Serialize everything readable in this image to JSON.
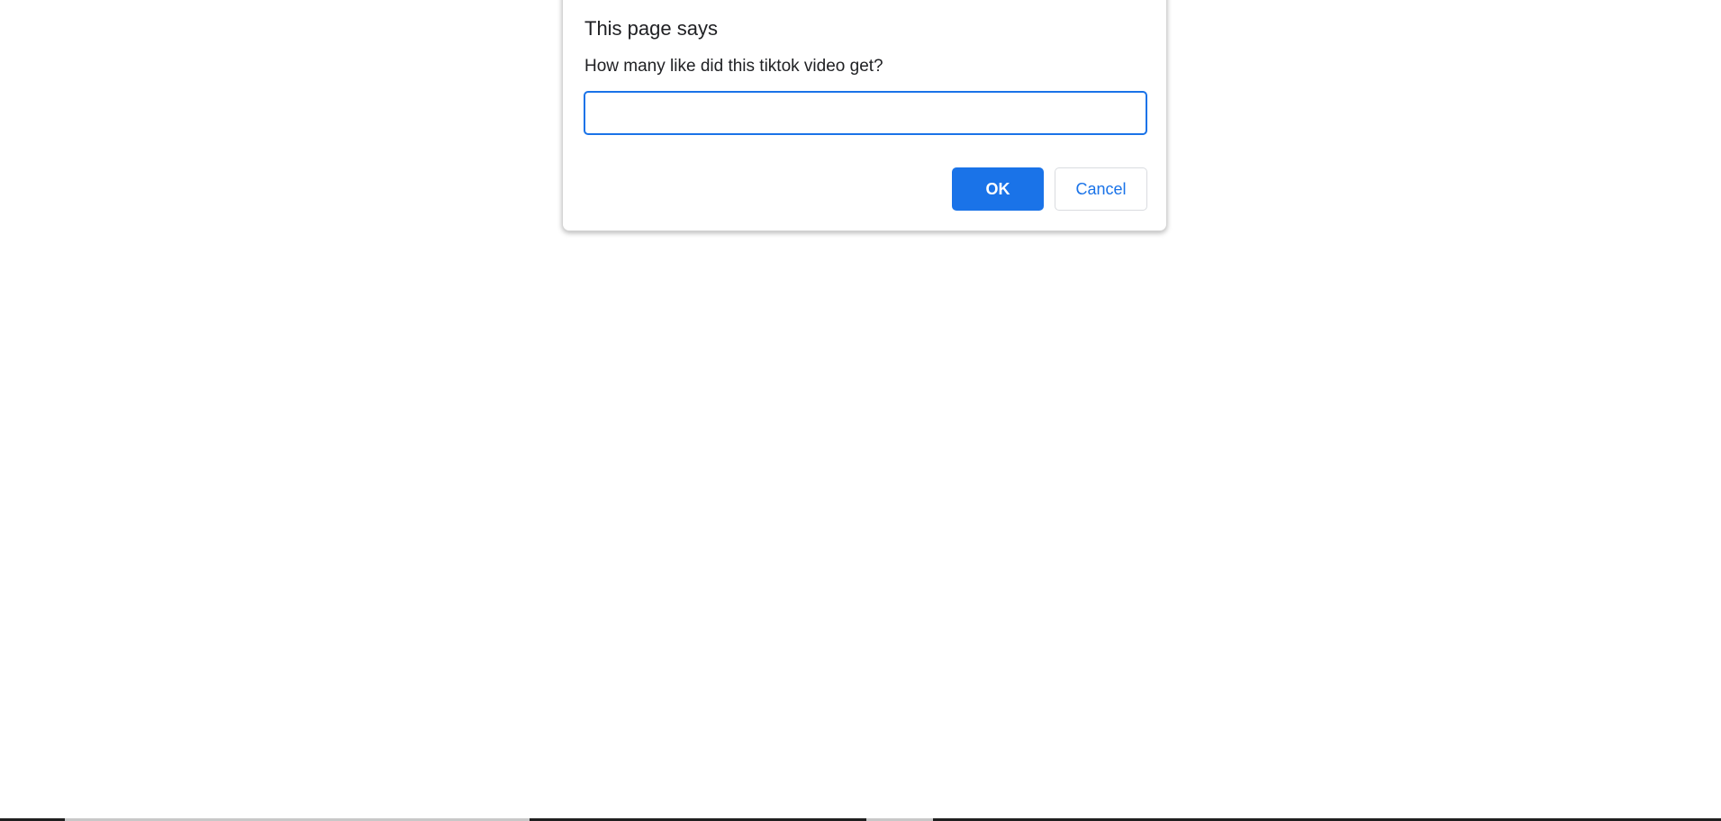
{
  "dialog": {
    "title": "This page says",
    "message": "How many like did this tiktok video get?",
    "input_value": "",
    "ok_label": "OK",
    "cancel_label": "Cancel"
  },
  "colors": {
    "accent": "#1a73e8",
    "text": "#202124",
    "background": "#ffffff"
  }
}
